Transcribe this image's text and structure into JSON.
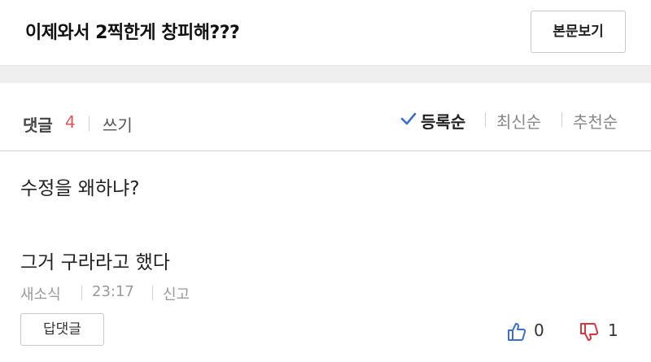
{
  "post": {
    "title": "이제와서 2찍한게 창피해???",
    "view_body_label": "본문보기"
  },
  "comments_bar": {
    "label": "댓글",
    "count": "4",
    "write_label": "쓰기",
    "sort_options": [
      "등록순",
      "최신순",
      "추천순"
    ],
    "active_sort": "등록순"
  },
  "comment": {
    "lines": [
      "수정을 왜하냐?",
      "그거 구라라고 했다"
    ],
    "author": "새소식",
    "time": "23:17",
    "report_label": "신고",
    "reply_label": "답댓글",
    "likes": "0",
    "dislikes": "1"
  },
  "colors": {
    "accent_count": "#e05555",
    "like_icon": "#3a6fd0",
    "dislike_icon": "#d9363e",
    "check_icon": "#3a6fd0"
  },
  "icons": {
    "sort_check": "check-icon",
    "like": "thumbs-up-icon",
    "dislike": "thumbs-down-icon"
  }
}
